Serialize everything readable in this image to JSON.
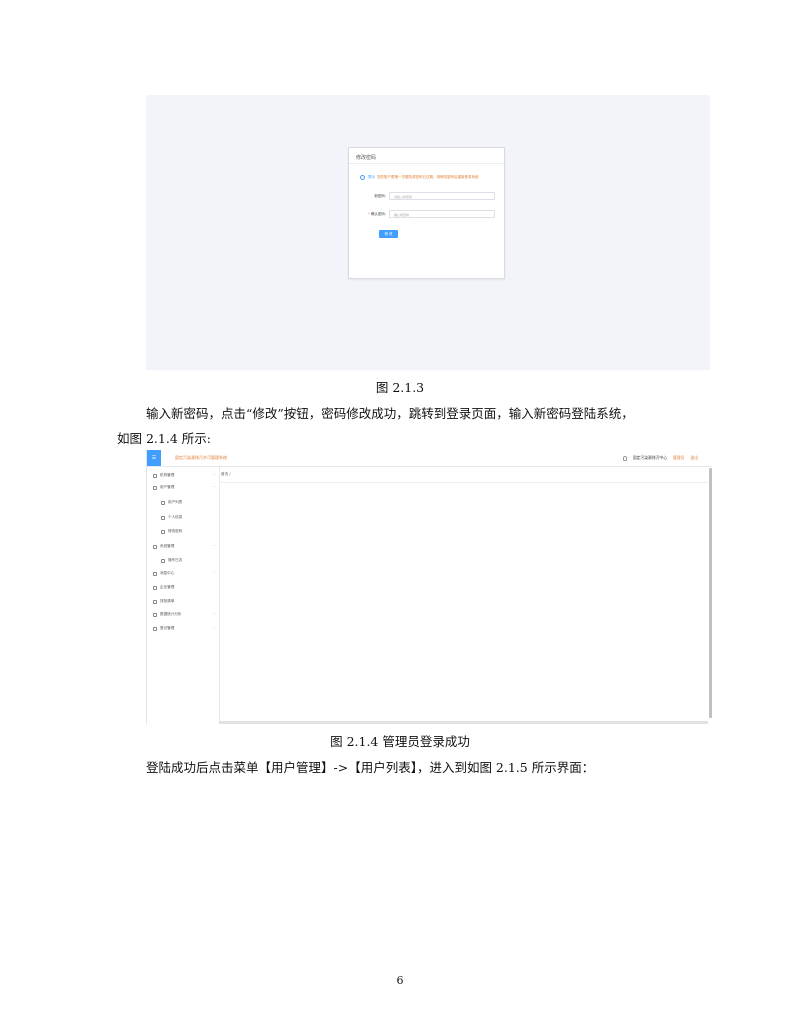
{
  "screenshot1": {
    "dialog_title": "修改密码",
    "notice_label": "提示",
    "notice_text": "您的账户是第一次登陆或密码已过期，请修改密码后重新登录系统",
    "fields": [
      {
        "label": "新密码:",
        "placeholder": "请输入新密码",
        "required": false
      },
      {
        "label": "确认密码:",
        "placeholder": "确认新密码",
        "required": true
      }
    ],
    "submit_label": "修 改"
  },
  "caption1": "图 2.1.3",
  "paragraph1_line1": "输入新密码，点击“修改”按钮，密码修改成功，跳转到登录页面，输入新密码登陆系统，",
  "paragraph1_line2": "如图 2.1.4 所示:",
  "screenshot2": {
    "logo_text": "☰",
    "system_title": "固定污染源排污许可管理系统",
    "org_name": "固定污染源排污中心",
    "admin_label": "管理员",
    "logout_label": "退出",
    "content_tab": "首页 /",
    "sidebar_items": [
      {
        "label": "机构管理",
        "sub": false,
        "chevron": "˅"
      },
      {
        "label": "用户管理",
        "sub": false,
        "chevron": "˄"
      },
      {
        "label": "用户列表",
        "sub": true,
        "chevron": ""
      },
      {
        "label": "个人信息",
        "sub": true,
        "chevron": ""
      },
      {
        "label": "修改密码",
        "sub": true,
        "chevron": ""
      },
      {
        "label": "系统管理",
        "sub": false,
        "chevron": "˄"
      },
      {
        "label": "操作日志",
        "sub": true,
        "chevron": ""
      },
      {
        "label": "消息中心",
        "sub": false,
        "chevron": "˅"
      },
      {
        "label": "企业管理",
        "sub": false,
        "chevron": ""
      },
      {
        "label": "排放清单",
        "sub": false,
        "chevron": ""
      },
      {
        "label": "数据统计分析",
        "sub": false,
        "chevron": "˅"
      },
      {
        "label": "登记管理",
        "sub": false,
        "chevron": "˅"
      }
    ]
  },
  "caption2": "图 2.1.4  管理员登录成功",
  "paragraph2": "登陆成功后点击菜单【用户管理】->【用户列表】，进入到如图 2.1.5 所示界面：",
  "page_number": "6"
}
